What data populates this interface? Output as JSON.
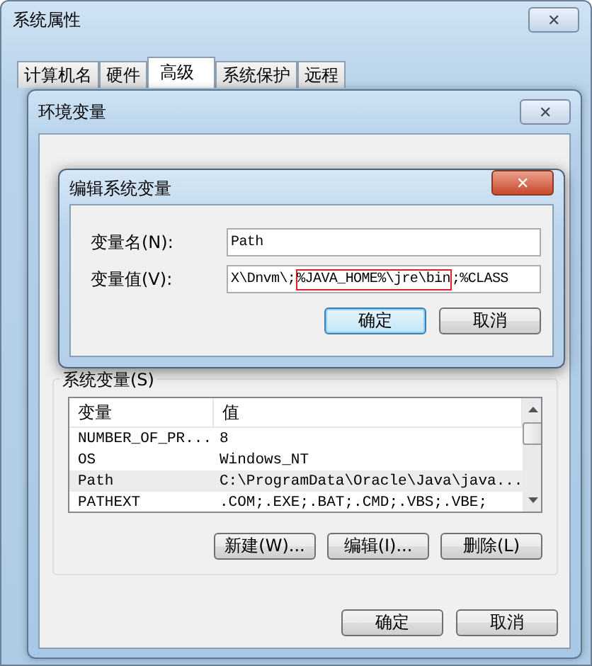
{
  "window": {
    "title": "系统属性",
    "close": "✕"
  },
  "tabs": [
    {
      "label": "计算机名",
      "selected": false
    },
    {
      "label": "硬件",
      "selected": false
    },
    {
      "label": "高级",
      "selected": true
    },
    {
      "label": "系统保护",
      "selected": false
    },
    {
      "label": "远程",
      "selected": false
    }
  ],
  "env_window": {
    "title": "环境变量",
    "close": "✕",
    "system_vars": {
      "title": "系统变量(S)",
      "columns": [
        "变量",
        "值"
      ],
      "rows": [
        {
          "name": "NUMBER_OF_PR...",
          "value": "8",
          "selected": false
        },
        {
          "name": "OS",
          "value": "Windows_NT",
          "selected": false
        },
        {
          "name": "Path",
          "value": "C:\\ProgramData\\Oracle\\Java\\java...",
          "selected": true
        },
        {
          "name": "PATHEXT",
          "value": ".COM;.EXE;.BAT;.CMD;.VBS;.VBE;",
          "selected": false
        }
      ],
      "buttons": [
        "新建(W)...",
        "编辑(I)...",
        "删除(L)"
      ]
    },
    "buttons": [
      "确定",
      "取消"
    ]
  },
  "edit_dialog": {
    "title": "编辑系统变量",
    "close": "✕",
    "name_label": "变量名(N):",
    "name_value": "Path",
    "value_label": "变量值(V):",
    "value_parts": [
      {
        "text": "X\\Dnvm\\;",
        "highlighted": false
      },
      {
        "text": "%JAVA_HOME%\\jre\\bin",
        "highlighted": true
      },
      {
        "text": ";%CLASS",
        "highlighted": false
      }
    ],
    "buttons": [
      {
        "label": "确定",
        "default": true
      },
      {
        "label": "取消",
        "default": false
      }
    ]
  }
}
